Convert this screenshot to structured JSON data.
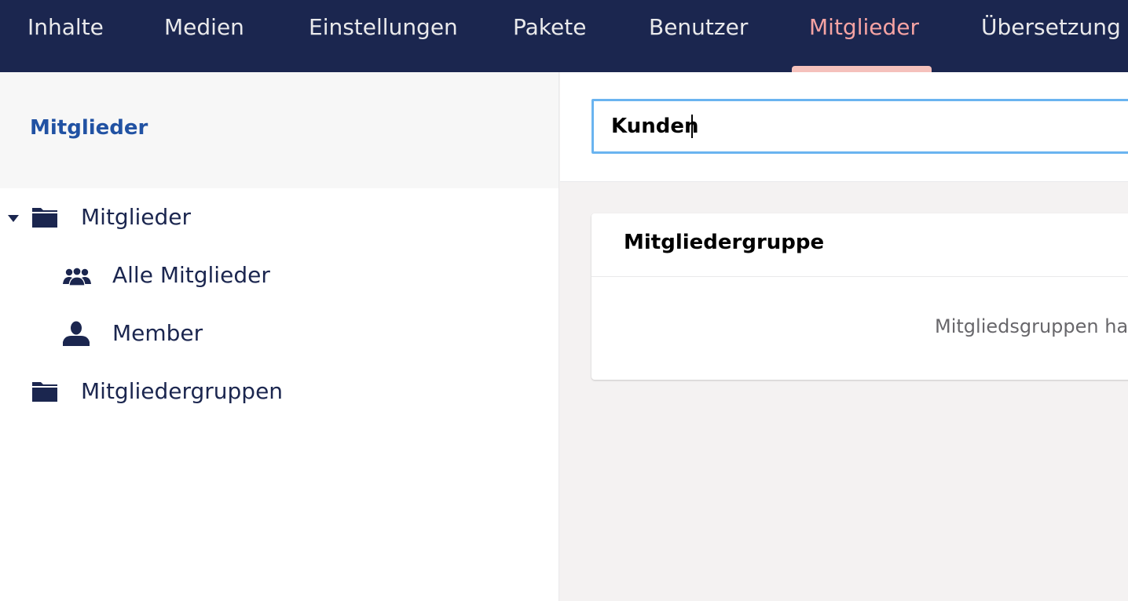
{
  "topnav": {
    "items": [
      {
        "label": "Inhalte"
      },
      {
        "label": "Medien"
      },
      {
        "label": "Einstellungen"
      },
      {
        "label": "Pakete"
      },
      {
        "label": "Benutzer"
      },
      {
        "label": "Mitglieder",
        "active": true
      },
      {
        "label": "Übersetzung"
      }
    ],
    "colors": {
      "background": "#1b264f",
      "active_text": "#f5a3a3",
      "indicator": "#f5c1bc"
    }
  },
  "sidebar": {
    "title": "Mitglieder",
    "tree": [
      {
        "label": "Mitglieder",
        "icon": "folder-icon",
        "expanded": true
      },
      {
        "label": "Alle Mitglieder",
        "icon": "users-icon"
      },
      {
        "label": "Member",
        "icon": "user-icon"
      },
      {
        "label": "Mitgliedergruppen",
        "icon": "folder-icon"
      }
    ]
  },
  "editor": {
    "name_value": "Kunden",
    "card": {
      "title": "Mitgliedergruppe",
      "body_text": "Mitgliedsgruppen ha"
    }
  }
}
